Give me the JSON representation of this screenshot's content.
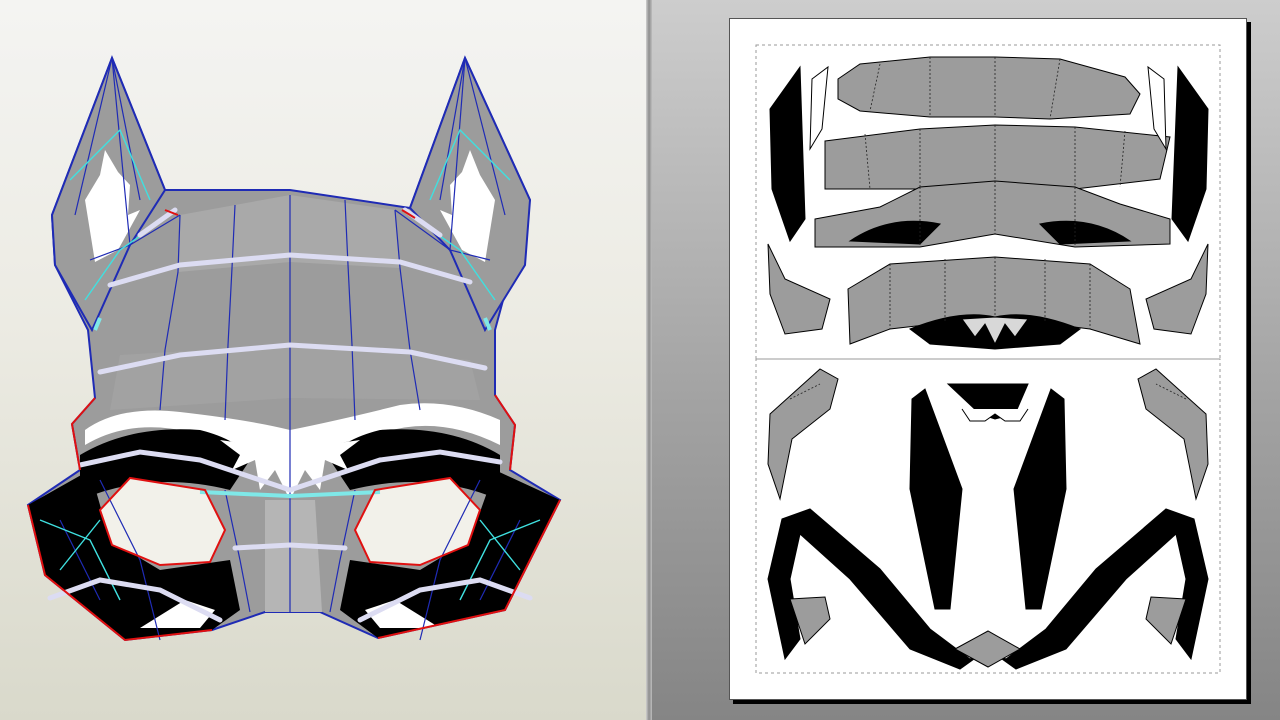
{
  "app": {
    "views": {
      "model_view": "3d-model-view",
      "unfold_view": "2d-unfold-view"
    }
  },
  "colors": {
    "panel_gray": "#9c9c9c",
    "light_gray": "#c6c6c6",
    "black_fill": "#000000",
    "white_fill": "#ffffff",
    "mesh_edge": "#1f2bb5",
    "fold_edge_cyan": "#3fe0e0",
    "cut_edge_red": "#e01010",
    "seam_highlight": "#e8e8f8",
    "paper": "#ffffff",
    "page_boundary_dash": "#9a9a9a"
  },
  "icons": {
    "split_handle": "splitter-handle-icon"
  }
}
